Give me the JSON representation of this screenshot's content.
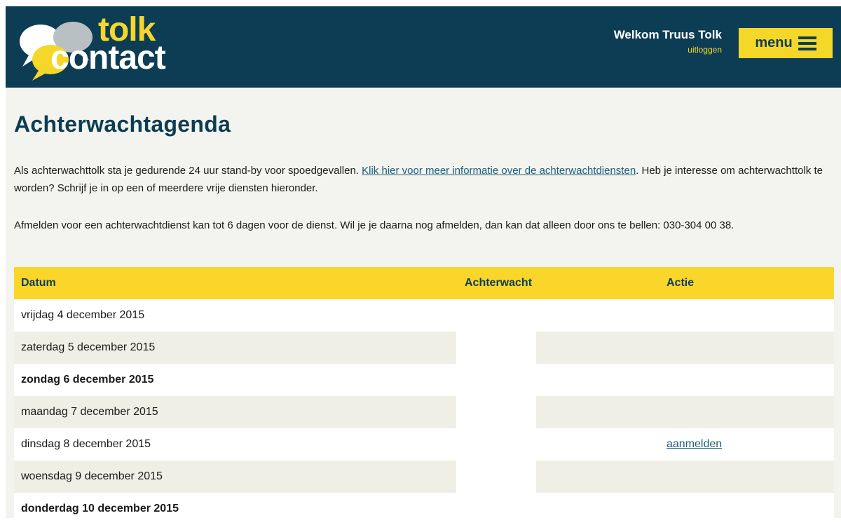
{
  "header": {
    "logo_top": "tolk",
    "logo_bottom": "contact",
    "welcome_prefix": "Welkom",
    "user_name": "Truus Tolk",
    "logout_label": "uitloggen",
    "menu_label": "menu"
  },
  "page": {
    "title": "Achterwachtagenda",
    "intro1_text_a": "Als achterwachttolk sta je gedurende 24 uur stand-by voor spoedgevallen. ",
    "intro1_link": "Klik hier voor meer informatie over de achterwachtdiensten",
    "intro1_text_b": ". Heb je interesse om achterwachttolk te worden? Schrijf je in op een of meerdere vrije diensten hieronder.",
    "intro2": "Afmelden voor een achterwachtdienst kan tot 6 dagen voor de dienst. Wil je je daarna nog afmelden, dan kan dat alleen door ons te bellen: 030-304 00 38."
  },
  "table": {
    "columns": [
      "Datum",
      "Achterwacht",
      "Actie"
    ],
    "rows": [
      {
        "datum": "vrijdag 4 december 2015",
        "achterwacht": "",
        "actie": ""
      },
      {
        "datum": "zaterdag 5 december 2015",
        "achterwacht": "",
        "actie": ""
      },
      {
        "datum": "zondag 6 december 2015",
        "achterwacht": "",
        "actie": ""
      },
      {
        "datum": "maandag 7 december 2015",
        "achterwacht": "",
        "actie": ""
      },
      {
        "datum": "dinsdag 8 december 2015",
        "achterwacht": "",
        "actie": "aanmelden"
      },
      {
        "datum": "woensdag 9 december 2015",
        "achterwacht": "",
        "actie": ""
      },
      {
        "datum": "donderdag 10 december 2015",
        "achterwacht": "",
        "actie": ""
      }
    ]
  },
  "colors": {
    "header_bg": "#0d3d54",
    "accent_yellow": "#f5d72a",
    "page_bg": "#f3f3ef",
    "link": "#1b5e7a"
  }
}
